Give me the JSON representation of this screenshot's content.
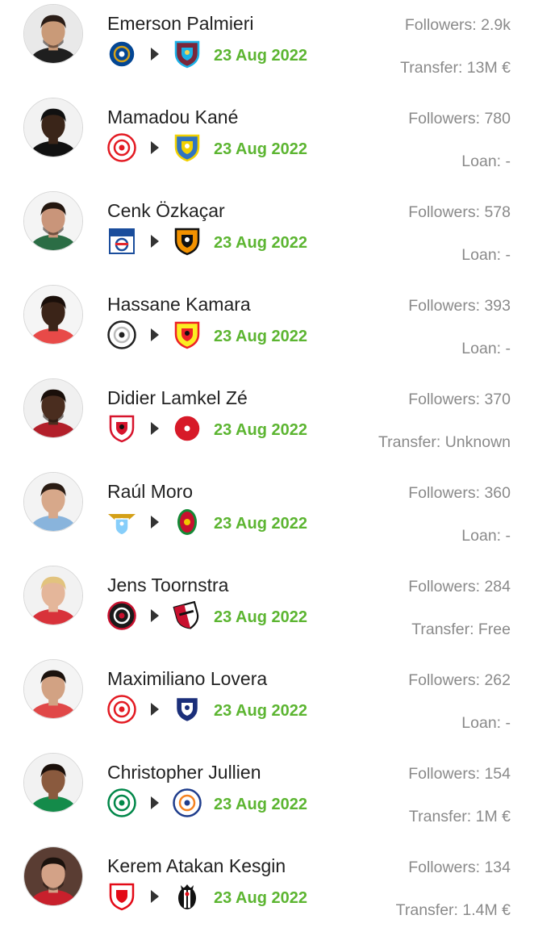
{
  "transfers": [
    {
      "name": "Emerson Palmieri",
      "followers": "Followers: 2.9k",
      "date": "23 Aug 2022",
      "fee": "Transfer: 13M €",
      "avatar": {
        "bg": "#e9e9e9",
        "skin": "#c99a78",
        "hair": "#2a1d17",
        "shirt": "#1f1f1f",
        "beard": true
      },
      "from": {
        "shape": "circle",
        "primary": "#034694",
        "secondary": "#ffffff",
        "accent": "#d4a017"
      },
      "to": {
        "shape": "shield",
        "primary": "#7a263a",
        "secondary": "#1bb1e7",
        "accent": "#f3d459"
      }
    },
    {
      "name": "Mamadou Kané",
      "followers": "Followers: 780",
      "date": "23 Aug 2022",
      "fee": "Loan: -",
      "avatar": {
        "bg": "#f2f2f2",
        "skin": "#3a2519",
        "hair": "#111111",
        "shirt": "#111111",
        "beard": false
      },
      "from": {
        "shape": "circle",
        "primary": "#ffffff",
        "secondary": "#e31b23",
        "accent": "#e31b23"
      },
      "to": {
        "shape": "shield",
        "primary": "#2f74c0",
        "secondary": "#f2d100",
        "accent": "#ffffff"
      }
    },
    {
      "name": "Cenk Özkaçar",
      "followers": "Followers: 578",
      "date": "23 Aug 2022",
      "fee": "Loan: -",
      "avatar": {
        "bg": "#f4f4f4",
        "skin": "#c9957a",
        "hair": "#231710",
        "shirt": "#2b6d45",
        "beard": true
      },
      "from": {
        "shape": "square",
        "primary": "#ffffff",
        "secondary": "#1a4d9c",
        "accent": "#e3262d"
      },
      "to": {
        "shape": "shield",
        "primary": "#f39200",
        "secondary": "#111111",
        "accent": "#ffffff"
      }
    },
    {
      "name": "Hassane Kamara",
      "followers": "Followers: 393",
      "date": "23 Aug 2022",
      "fee": "Loan: -",
      "avatar": {
        "bg": "#f5f5f5",
        "skin": "#3b2418",
        "hair": "#1a0f0a",
        "shirt": "#e84a48",
        "beard": false
      },
      "from": {
        "shape": "circle",
        "primary": "#ffffff",
        "secondary": "#222222",
        "accent": "#bbbbbb"
      },
      "to": {
        "shape": "shield",
        "primary": "#fbee23",
        "secondary": "#ed2127",
        "accent": "#111111"
      }
    },
    {
      "name": "Didier Lamkel Zé",
      "followers": "Followers: 370",
      "date": "23 Aug 2022",
      "fee": "Transfer: Unknown",
      "avatar": {
        "bg": "#f0f0f0",
        "skin": "#4a2d1f",
        "hair": "#1a0f0a",
        "shirt": "#b21f2a",
        "beard": true
      },
      "from": {
        "shape": "shield",
        "primary": "#ffffff",
        "secondary": "#d7142c",
        "accent": "#111111"
      },
      "to": {
        "shape": "circle",
        "primary": "#d71a28",
        "secondary": "#ffffff",
        "accent": "#d71a28"
      }
    },
    {
      "name": "Raúl Moro",
      "followers": "Followers: 360",
      "date": "23 Aug 2022",
      "fee": "Loan: -",
      "avatar": {
        "bg": "#f3f3f3",
        "skin": "#d7a88a",
        "hair": "#2a1c14",
        "shirt": "#89b4dc",
        "beard": false
      },
      "from": {
        "shape": "eagle",
        "primary": "#87cefa",
        "secondary": "#ffffff",
        "accent": "#d4a017"
      },
      "to": {
        "shape": "oval",
        "primary": "#c8102e",
        "secondary": "#138a36",
        "accent": "#f2c500"
      }
    },
    {
      "name": "Jens Toornstra",
      "followers": "Followers: 284",
      "date": "23 Aug 2022",
      "fee": "Transfer: Free",
      "avatar": {
        "bg": "#f2f2f2",
        "skin": "#e4b69a",
        "hair": "#e2c37e",
        "shirt": "#d8323a",
        "beard": false
      },
      "from": {
        "shape": "circle",
        "primary": "#1a1a1a",
        "secondary": "#c8102e",
        "accent": "#ffffff"
      },
      "to": {
        "shape": "tilted",
        "primary": "#ffffff",
        "secondary": "#c8102e",
        "accent": "#111111"
      }
    },
    {
      "name": "Maximiliano Lovera",
      "followers": "Followers: 262",
      "date": "23 Aug 2022",
      "fee": "Loan: -",
      "avatar": {
        "bg": "#f4f4f4",
        "skin": "#d2a283",
        "hair": "#1b120d",
        "shirt": "#e04848",
        "beard": false
      },
      "from": {
        "shape": "circle",
        "primary": "#ffffff",
        "secondary": "#e31b23",
        "accent": "#e31b23"
      },
      "to": {
        "shape": "shield",
        "primary": "#1b2f7a",
        "secondary": "#ffffff",
        "accent": "#1b2f7a"
      }
    },
    {
      "name": "Christopher Jullien",
      "followers": "Followers: 154",
      "date": "23 Aug 2022",
      "fee": "Transfer: 1M €",
      "avatar": {
        "bg": "#f2f2f2",
        "skin": "#8a5a3e",
        "hair": "#1a0f0a",
        "shirt": "#148b4a",
        "beard": false
      },
      "from": {
        "shape": "circle",
        "primary": "#ffffff",
        "secondary": "#018749",
        "accent": "#018749"
      },
      "to": {
        "shape": "circle",
        "primary": "#ffffff",
        "secondary": "#1f3d8c",
        "accent": "#f58220"
      }
    },
    {
      "name": "Kerem Atakan Kesgin",
      "followers": "Followers: 134",
      "date": "23 Aug 2022",
      "fee": "Transfer: 1.4M €",
      "avatar": {
        "bg": "#5a3d33",
        "skin": "#d3a287",
        "hair": "#1b120d",
        "shirt": "#c8202c",
        "beard": true
      },
      "from": {
        "shape": "shield",
        "primary": "#ffffff",
        "secondary": "#e30a17",
        "accent": "#e30a17"
      },
      "to": {
        "shape": "bjk",
        "primary": "#ffffff",
        "secondary": "#111111",
        "accent": "#e30a17"
      }
    }
  ]
}
